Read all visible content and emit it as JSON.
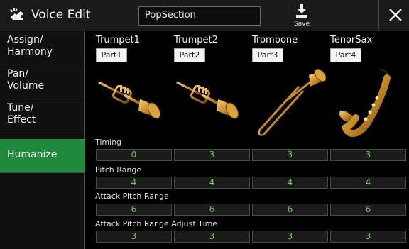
{
  "header": {
    "title": "Voice Edit",
    "song_name": "PopSection",
    "save_label": "Save"
  },
  "sidebar": {
    "items": [
      {
        "label": "Assign/\nHarmony",
        "active": false
      },
      {
        "label": "Pan/\nVolume",
        "active": false
      },
      {
        "label": "Tune/\nEffect",
        "active": false
      },
      {
        "label": "Humanize",
        "active": true
      }
    ]
  },
  "parts": [
    {
      "name": "Trumpet1",
      "button": "Part1",
      "instrument": "trumpet"
    },
    {
      "name": "Trumpet2",
      "button": "Part2",
      "instrument": "trumpet"
    },
    {
      "name": "Trombone",
      "button": "Part3",
      "instrument": "trombone"
    },
    {
      "name": "TenorSax",
      "button": "Part4",
      "instrument": "saxophone"
    }
  ],
  "parameters": [
    {
      "label": "Timing",
      "values": [
        "0",
        "3",
        "3",
        "3"
      ]
    },
    {
      "label": "Pitch Range",
      "values": [
        "4",
        "4",
        "4",
        "4"
      ]
    },
    {
      "label": "Attack Pitch Range",
      "values": [
        "6",
        "6",
        "6",
        "6"
      ]
    },
    {
      "label": "Attack Pitch Range Adjust Time",
      "values": [
        "3",
        "3",
        "3",
        "3"
      ]
    }
  ],
  "colors": {
    "active_tab": "#1f8a3c",
    "value_text": "#5fd14a"
  }
}
